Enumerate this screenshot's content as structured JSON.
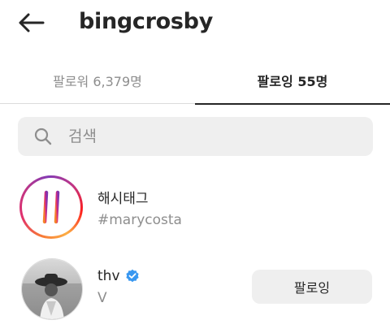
{
  "header": {
    "username": "bingcrosby",
    "back_icon": "arrow-left-icon"
  },
  "tabs": [
    {
      "label": "팔로워 6,379명",
      "active": false
    },
    {
      "label": "팔로잉 55명",
      "active": true
    }
  ],
  "search": {
    "placeholder": "검색",
    "value": "",
    "icon": "search-icon"
  },
  "list": [
    {
      "type": "hashtag",
      "title": "해시태그",
      "subtitle": "#marycosta",
      "icon": "hashtag-icon"
    },
    {
      "type": "user",
      "name": "thv",
      "verified": true,
      "subtitle": "V",
      "button_label": "팔로잉"
    }
  ],
  "colors": {
    "text": "#262626",
    "muted": "#8e8e8e",
    "search_bg": "#efefef",
    "verified": "#3897f0"
  }
}
